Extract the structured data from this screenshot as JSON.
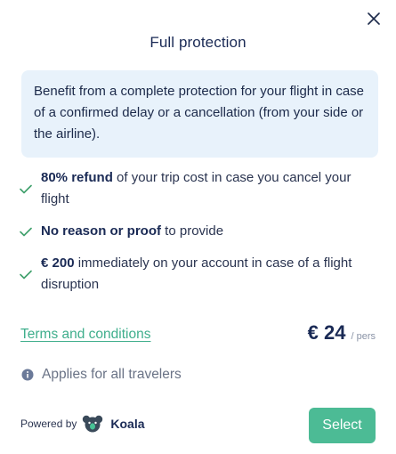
{
  "modal": {
    "title": "Full protection",
    "close_icon": "close-icon",
    "description": "Benefit from a complete protection for your flight in case of a confirmed delay or a cancellation (from your side or the airline).",
    "features": [
      {
        "bold": "80% refund",
        "rest": " of your trip cost in case you cancel your flight",
        "icon": "check-icon"
      },
      {
        "bold": "No reason or proof",
        "rest": " to provide",
        "icon": "check-icon"
      },
      {
        "bold": "€ 200",
        "rest": " immediately on your account in case of a flight disruption",
        "icon": "check-icon"
      }
    ],
    "terms_link": "Terms and conditions",
    "price": {
      "amount": "€ 24",
      "unit": "/ pers"
    },
    "applies": {
      "icon": "info-icon",
      "text": "Applies for all travelers"
    },
    "powered_by": {
      "label": "Powered by",
      "brand": "Koala",
      "logo": "koala-logo-icon"
    },
    "select_button": "Select",
    "colors": {
      "accent_green": "#4cbb95",
      "link_green": "#3fae8c",
      "navy": "#1a2a55",
      "info_box_bg": "#e8f2fb"
    }
  }
}
